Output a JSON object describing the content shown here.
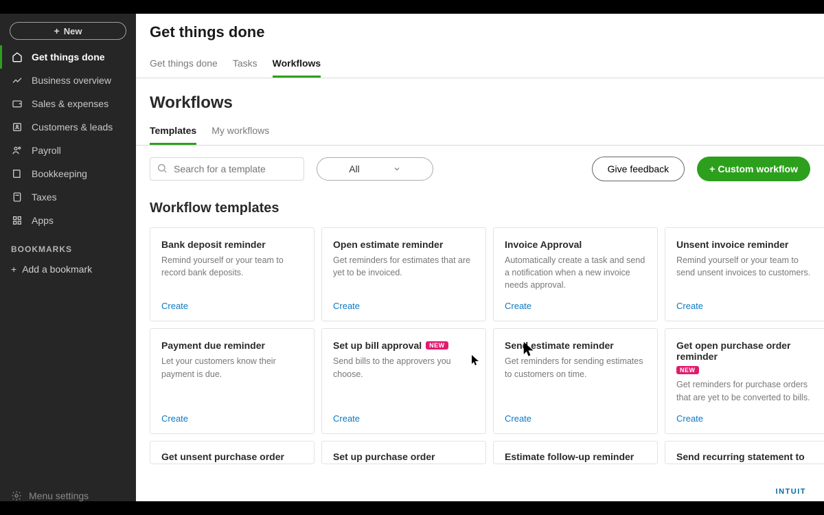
{
  "sidebar": {
    "new_label": "New",
    "items": [
      {
        "label": "Get things done"
      },
      {
        "label": "Business overview"
      },
      {
        "label": "Sales & expenses"
      },
      {
        "label": "Customers & leads"
      },
      {
        "label": "Payroll"
      },
      {
        "label": "Bookkeeping"
      },
      {
        "label": "Taxes"
      },
      {
        "label": "Apps"
      }
    ],
    "bookmarks_label": "BOOKMARKS",
    "add_bookmark": "Add a bookmark",
    "menu_settings": "Menu settings"
  },
  "header": {
    "page_title": "Get things done",
    "primary_tabs": [
      {
        "label": "Get things done"
      },
      {
        "label": "Tasks"
      },
      {
        "label": "Workflows"
      }
    ],
    "section_title": "Workflows",
    "secondary_tabs": [
      {
        "label": "Templates"
      },
      {
        "label": "My workflows"
      }
    ]
  },
  "toolbar": {
    "search_placeholder": "Search for a template",
    "filter_value": "All",
    "give_feedback": "Give feedback",
    "custom_workflow": "Custom workflow"
  },
  "templates_title": "Workflow templates",
  "templates": [
    {
      "title": "Bank deposit reminder",
      "desc": "Remind yourself or your team to record bank deposits.",
      "create": "Create",
      "new": false
    },
    {
      "title": "Open estimate reminder",
      "desc": "Get reminders for estimates that are yet to be invoiced.",
      "create": "Create",
      "new": false
    },
    {
      "title": "Invoice Approval",
      "desc": "Automatically create a task and send a notification when a new invoice needs approval.",
      "create": "Create",
      "new": false
    },
    {
      "title": "Unsent invoice reminder",
      "desc": "Remind yourself or your team to send unsent invoices to customers.",
      "create": "Create",
      "new": false
    },
    {
      "title": "Payment due reminder",
      "desc": "Let your customers know their payment is due.",
      "create": "Create",
      "new": false
    },
    {
      "title": "Set up bill approval",
      "desc": "Send bills to the approvers you choose.",
      "create": "Create",
      "new": true
    },
    {
      "title": "Send estimate reminder",
      "desc": "Get reminders for sending estimates to customers on time.",
      "create": "Create",
      "new": false
    },
    {
      "title": "Get open purchase order reminder",
      "desc": "Get reminders for purchase orders that are yet to be converted to bills.",
      "create": "Create",
      "new": true
    }
  ],
  "templates_row3": [
    {
      "title": "Get unsent purchase order"
    },
    {
      "title": "Set up purchase order"
    },
    {
      "title": "Estimate follow-up reminder"
    },
    {
      "title": "Send recurring statement to"
    }
  ],
  "badge_new": "NEW",
  "brand_mark": "INTUIT"
}
